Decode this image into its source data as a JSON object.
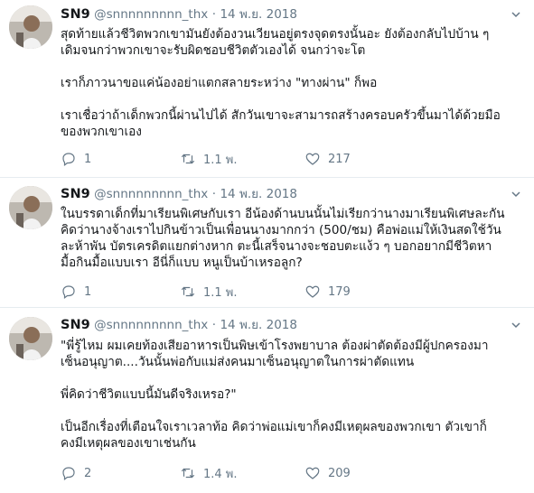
{
  "tweets": [
    {
      "name": "SN9",
      "handle": "@snnnnnnnnn_thx",
      "sep": "·",
      "date": "14 พ.ย. 2018",
      "lines": [
        "สุดท้ายแล้วชีวิตพวกเขามันยังต้องวนเวียนอยู่ตรงจุดตรงนั้นอะ ยังต้องกลับไปบ้าน ๆ",
        "เดิมจนกว่าพวกเขาจะรับผิดชอบชีวิตตัวเองได้ จนกว่าจะโต",
        "",
        "เราก็ภาวนาขอแค่น้องอย่าแตกสลายระหว่าง \"ทางผ่าน\" ก็พอ",
        "",
        "เราเชื่อว่าถ้าเด็กพวกนี้ผ่านไปได้ สักวันเขาจะสามารถสร้างครอบครัวขึ้นมาได้ด้วยมือ",
        "ของพวกเขาเอง"
      ],
      "replies": "1",
      "retweets": "1.1 พ.",
      "likes": "217"
    },
    {
      "name": "SN9",
      "handle": "@snnnnnnnnn_thx",
      "sep": "·",
      "date": "14 พ.ย. 2018",
      "lines": [
        "ในบรรดาเด็กที่มาเรียนพิเศษกับเรา อีน้องด้านบนนั้นไม่เรียกว่านางมาเรียนพิเศษละกัน",
        "คิดว่านางจ้างเราไปกินข้าวเป็นเพื่อนนางมากกว่า (500/ชม) คือพ่อแม่ให้เงินสดใช้วัน",
        "ละห้าพัน บัตรเครดิตแยกต่างหาก ตะนี้เสร็จนางจะชอบตะแง้ว ๆ บอกอยากมีชีวิตหา",
        "มื้อกินมื้อแบบเรา อีนี่ก็แบบ หนูเป็นบ้าเหรอลูก?"
      ],
      "replies": "1",
      "retweets": "1.1 พ.",
      "likes": "179"
    },
    {
      "name": "SN9",
      "handle": "@snnnnnnnnn_thx",
      "sep": "·",
      "date": "14 พ.ย. 2018",
      "lines": [
        "\"พี่รู้ไหม ผมเคยท้องเสียอาหารเป็นพิษเข้าโรงพยาบาล ต้องผ่าตัดต้องมีผู้ปกครองมา",
        "เซ็นอนุญาต....วันนั้นพ่อกับแม่ส่งคนมาเซ็นอนุญาตในการผ่าตัดแทน",
        "",
        "พี่คิดว่าชีวิตแบบนี้มันดีจริงเหรอ?\"",
        "",
        "เป็นอีกเรื่องที่เตือนใจเราเวลาท้อ คิดว่าพ่อแม่เขาก็คงมีเหตุผลของพวกเขา ตัวเขาก็",
        "คงมีเหตุผลของเขาเช่นกัน"
      ],
      "replies": "2",
      "retweets": "1.4 พ.",
      "likes": "209"
    }
  ],
  "icons": {
    "reply": "reply-icon",
    "retweet": "retweet-icon",
    "like": "heart-icon",
    "more": "chevron-down-icon",
    "avatar": "avatar"
  }
}
